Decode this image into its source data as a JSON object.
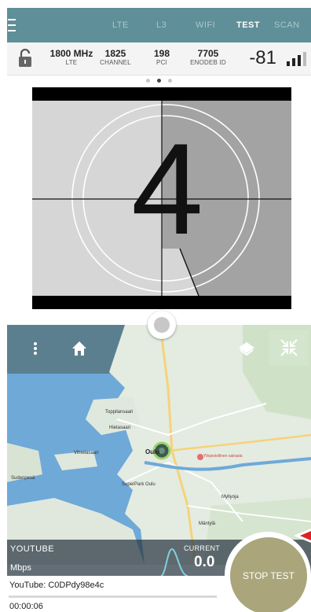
{
  "tabs": [
    {
      "label": "LTE",
      "active": false
    },
    {
      "label": "L3",
      "active": false
    },
    {
      "label": "WIFI",
      "active": false
    },
    {
      "label": "TEST",
      "active": true
    },
    {
      "label": "SCAN",
      "active": false
    }
  ],
  "info": {
    "band": {
      "value": "1800 MHz",
      "label": "LTE"
    },
    "channel": {
      "value": "1825",
      "label": "CHANNEL"
    },
    "pci": {
      "value": "198",
      "label": "PCI"
    },
    "enodeb": {
      "value": "7705",
      "label": "ENODEB ID"
    },
    "rssi": "-81"
  },
  "pager": {
    "count": 3,
    "active": 1
  },
  "video": {
    "countdown": "4"
  },
  "map": {
    "labels": [
      "Toppilansaari",
      "Hietasaari",
      "Vihrelasaari",
      "Sudenpesä",
      "Oulu",
      "Yliopistollinen sairaala",
      "SuperPark Oulu",
      "Myllyoja",
      "Mäntylä"
    ]
  },
  "test": {
    "name": "YOUTUBE",
    "unit": "Mbps",
    "current_label": "CURRENT",
    "current_value": "0.0",
    "stop_label": "STOP TEST",
    "video_id": "YouTube: C0DPdy98e4c",
    "elapsed": "00:00:06",
    "progress": 0
  },
  "colors": {
    "topbar": "#5f8f98",
    "stop_button": "#aaa57b",
    "map_water": "#6ea9d8",
    "map_land": "#e6ebe4"
  }
}
